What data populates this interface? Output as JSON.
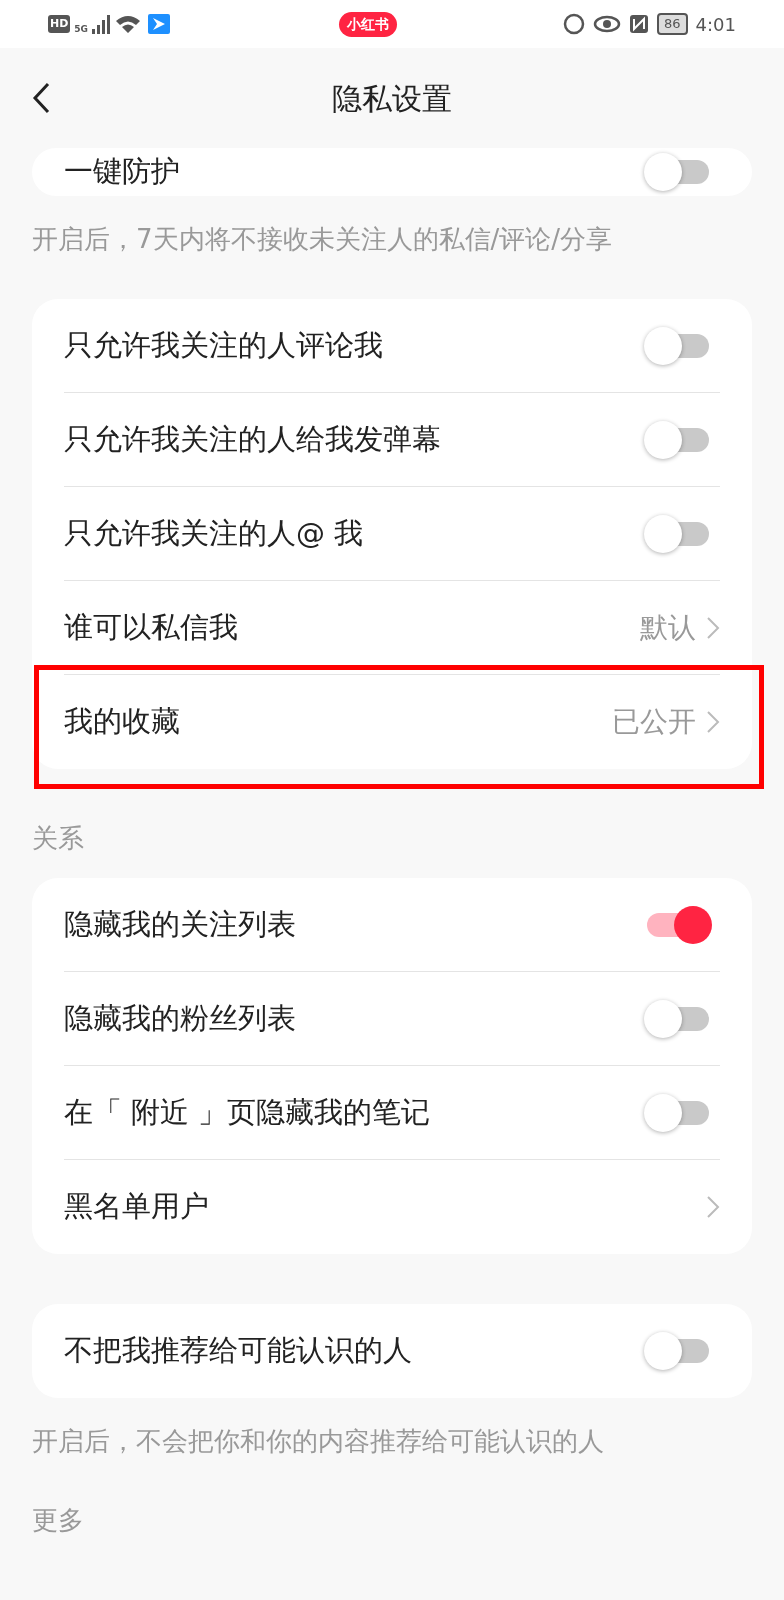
{
  "status_bar": {
    "hd": "HD",
    "network": "5G",
    "app_badge": "小红书",
    "battery": "86",
    "time": "4:01"
  },
  "header": {
    "title": "隐私设置"
  },
  "sections": [
    {
      "rows": [
        {
          "kind": "toggle",
          "label": "一键防护",
          "on": false
        }
      ],
      "note": "开启后，7天内将不接收未关注人的私信/评论/分享"
    },
    {
      "rows": [
        {
          "kind": "toggle",
          "label": "只允许我关注的人评论我",
          "on": false
        },
        {
          "kind": "toggle",
          "label": "只允许我关注的人给我发弹幕",
          "on": false
        },
        {
          "kind": "toggle",
          "label": "只允许我关注的人@ 我",
          "on": false
        },
        {
          "kind": "link",
          "label": "谁可以私信我",
          "value": "默认"
        },
        {
          "kind": "link",
          "label": "我的收藏",
          "value": "已公开",
          "highlighted": true
        }
      ]
    },
    {
      "title": "关系",
      "rows": [
        {
          "kind": "toggle",
          "label": "隐藏我的关注列表",
          "on": true
        },
        {
          "kind": "toggle",
          "label": "隐藏我的粉丝列表",
          "on": false
        },
        {
          "kind": "toggle",
          "label": "在「 附近 」页隐藏我的笔记",
          "on": false
        },
        {
          "kind": "link",
          "label": "黑名单用户"
        }
      ]
    },
    {
      "rows": [
        {
          "kind": "toggle",
          "label": "不把我推荐给可能认识的人",
          "on": false
        }
      ],
      "note": "开启后，不会把你和你的内容推荐给可能认识的人"
    },
    {
      "title": "更多"
    }
  ]
}
